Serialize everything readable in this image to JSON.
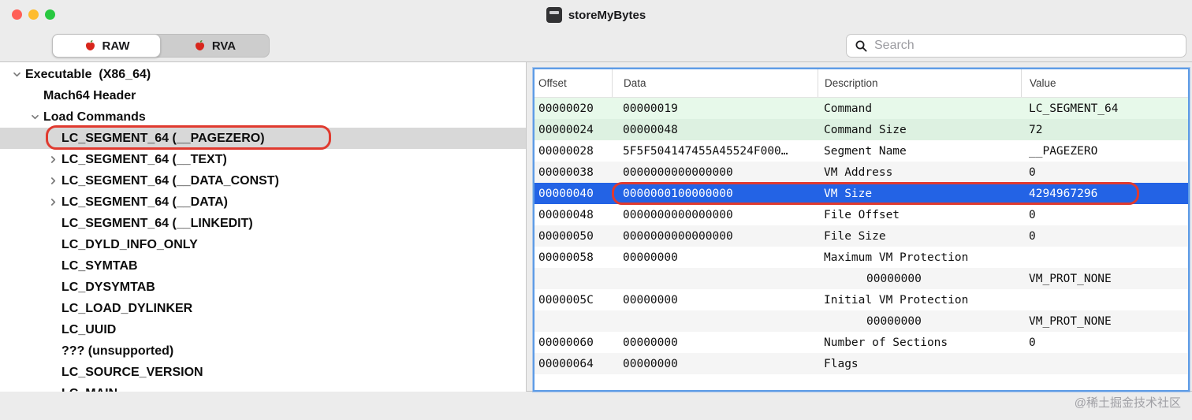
{
  "window": {
    "title": "storeMyBytes"
  },
  "toolbar": {
    "segments": [
      {
        "label": "RAW",
        "selected": true
      },
      {
        "label": "RVA",
        "selected": false
      }
    ],
    "search": {
      "placeholder": "Search"
    }
  },
  "sidebar": {
    "items": [
      {
        "label": "Executable  (X86_64)",
        "indent": 0,
        "chevron": "down",
        "selected": false
      },
      {
        "label": "Mach64 Header",
        "indent": 1,
        "chevron": "none",
        "selected": false
      },
      {
        "label": "Load Commands",
        "indent": 1,
        "chevron": "down",
        "selected": false
      },
      {
        "label": "LC_SEGMENT_64 (__PAGEZERO)",
        "indent": 2,
        "chevron": "none",
        "selected": true
      },
      {
        "label": "LC_SEGMENT_64 (__TEXT)",
        "indent": 2,
        "chevron": "right",
        "selected": false
      },
      {
        "label": "LC_SEGMENT_64 (__DATA_CONST)",
        "indent": 2,
        "chevron": "right",
        "selected": false
      },
      {
        "label": "LC_SEGMENT_64 (__DATA)",
        "indent": 2,
        "chevron": "right",
        "selected": false
      },
      {
        "label": "LC_SEGMENT_64 (__LINKEDIT)",
        "indent": 2,
        "chevron": "none",
        "selected": false
      },
      {
        "label": "LC_DYLD_INFO_ONLY",
        "indent": 2,
        "chevron": "none",
        "selected": false
      },
      {
        "label": "LC_SYMTAB",
        "indent": 2,
        "chevron": "none",
        "selected": false
      },
      {
        "label": "LC_DYSYMTAB",
        "indent": 2,
        "chevron": "none",
        "selected": false
      },
      {
        "label": "LC_LOAD_DYLINKER",
        "indent": 2,
        "chevron": "none",
        "selected": false
      },
      {
        "label": "LC_UUID",
        "indent": 2,
        "chevron": "none",
        "selected": false
      },
      {
        "label": "??? (unsupported)",
        "indent": 2,
        "chevron": "none",
        "selected": false
      },
      {
        "label": "LC_SOURCE_VERSION",
        "indent": 2,
        "chevron": "none",
        "selected": false
      },
      {
        "label": "LC_MAIN",
        "indent": 2,
        "chevron": "none",
        "selected": false
      }
    ]
  },
  "table": {
    "columns": [
      "Offset",
      "Data",
      "Description",
      "Value"
    ],
    "rows": [
      {
        "offset": "00000020",
        "data": "00000019",
        "description": "Command",
        "value": "LC_SEGMENT_64",
        "bg": "green1",
        "desc_indent": false
      },
      {
        "offset": "00000024",
        "data": "00000048",
        "description": "Command Size",
        "value": "72",
        "bg": "green2",
        "desc_indent": false
      },
      {
        "offset": "00000028",
        "data": "5F5F504147455A45524F000…",
        "description": "Segment Name",
        "value": "__PAGEZERO",
        "bg": "white",
        "desc_indent": false
      },
      {
        "offset": "00000038",
        "data": "0000000000000000",
        "description": "VM Address",
        "value": "0",
        "bg": "gray",
        "desc_indent": false
      },
      {
        "offset": "00000040",
        "data": "0000000100000000",
        "description": "VM Size",
        "value": "4294967296",
        "bg": "selected",
        "desc_indent": false
      },
      {
        "offset": "00000048",
        "data": "0000000000000000",
        "description": "File Offset",
        "value": "0",
        "bg": "white",
        "desc_indent": false
      },
      {
        "offset": "00000050",
        "data": "0000000000000000",
        "description": "File Size",
        "value": "0",
        "bg": "gray",
        "desc_indent": false
      },
      {
        "offset": "00000058",
        "data": "00000000",
        "description": "Maximum VM Protection",
        "value": "",
        "bg": "white",
        "desc_indent": false
      },
      {
        "offset": "",
        "data": "",
        "description": "00000000",
        "value": "VM_PROT_NONE",
        "bg": "gray",
        "desc_indent": true
      },
      {
        "offset": "0000005C",
        "data": "00000000",
        "description": "Initial VM Protection",
        "value": "",
        "bg": "white",
        "desc_indent": false
      },
      {
        "offset": "",
        "data": "",
        "description": "00000000",
        "value": "VM_PROT_NONE",
        "bg": "gray",
        "desc_indent": true
      },
      {
        "offset": "00000060",
        "data": "00000000",
        "description": "Number of Sections",
        "value": "0",
        "bg": "white",
        "desc_indent": false
      },
      {
        "offset": "00000064",
        "data": "00000000",
        "description": "Flags",
        "value": "",
        "bg": "gray",
        "desc_indent": false
      }
    ]
  },
  "annotations": {
    "sidebar_highlight_target": "LC_SEGMENT_64 (__PAGEZERO)",
    "table_highlight_target": "VM Size row"
  },
  "watermark": "@稀土掘金技术社区",
  "colors": {
    "selection_blue": "#2363e5",
    "annotation_red": "#e03a2f",
    "focus_ring_blue": "#5e9ce6",
    "row_green_1": "#e7f9ea",
    "row_green_2": "#ddf1e1",
    "sidebar_selection_gray": "#d8d8d8",
    "traffic_red": "#ff5f57",
    "traffic_yellow": "#febc2e",
    "traffic_green": "#28c840"
  }
}
